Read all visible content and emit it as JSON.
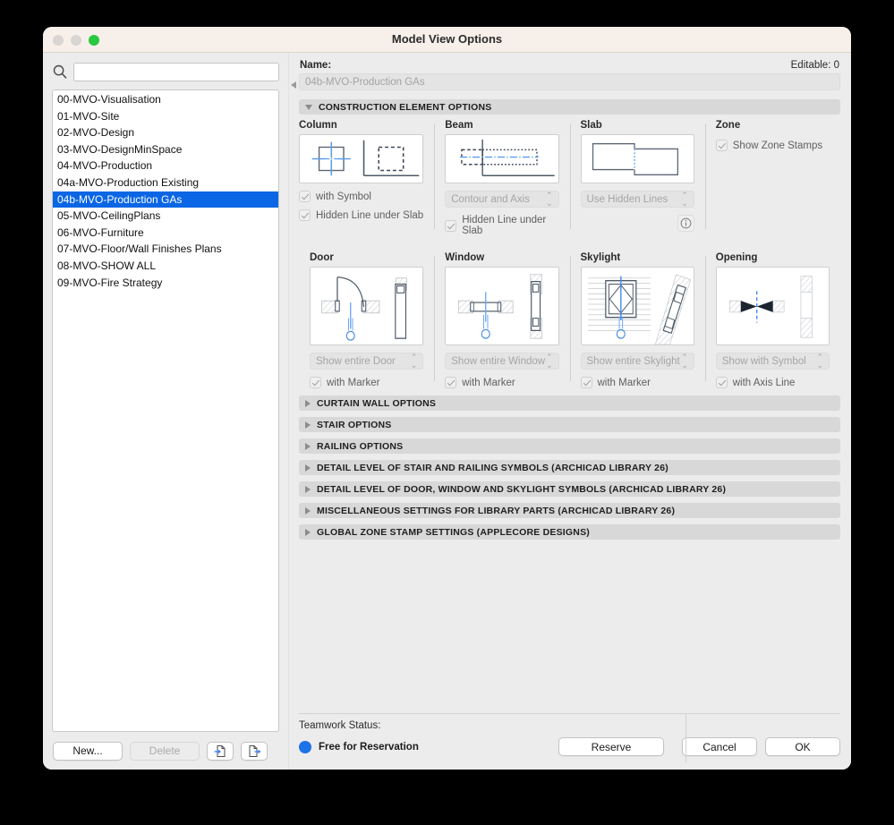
{
  "window": {
    "title": "Model View Options",
    "traffic_lights": [
      "close-inactive",
      "minimize-inactive",
      "maximize-green"
    ]
  },
  "sidebar": {
    "search": {
      "value": "",
      "placeholder": "",
      "icon": "search-icon"
    },
    "items": [
      {
        "label": "00-MVO-Visualisation",
        "selected": false
      },
      {
        "label": "01-MVO-Site",
        "selected": false
      },
      {
        "label": "02-MVO-Design",
        "selected": false
      },
      {
        "label": "03-MVO-DesignMinSpace",
        "selected": false
      },
      {
        "label": "04-MVO-Production",
        "selected": false
      },
      {
        "label": "04a-MVO-Production Existing",
        "selected": false
      },
      {
        "label": "04b-MVO-Production GAs",
        "selected": true
      },
      {
        "label": "05-MVO-CeilingPlans",
        "selected": false
      },
      {
        "label": "06-MVO-Furniture",
        "selected": false
      },
      {
        "label": "07-MVO-Floor/Wall Finishes Plans",
        "selected": false
      },
      {
        "label": "08-MVO-SHOW ALL",
        "selected": false
      },
      {
        "label": "09-MVO-Fire Strategy",
        "selected": false
      }
    ],
    "buttons": {
      "new": "New...",
      "delete": "Delete",
      "import_icon": "import-document-icon",
      "export_icon": "export-document-icon"
    },
    "selection_color": "#0a66e4"
  },
  "main": {
    "name_label": "Name:",
    "editable_label": "Editable: 0",
    "name_value": "04b-MVO-Production GAs",
    "construction_section": {
      "title": "CONSTRUCTION ELEMENT OPTIONS",
      "expanded": true
    },
    "cells": {
      "column": {
        "title": "Column",
        "preview_icon": "column-symbol-preview",
        "checkboxes": [
          {
            "label": "with Symbol",
            "checked": true
          },
          {
            "label": "Hidden Line under Slab",
            "checked": true
          }
        ]
      },
      "beam": {
        "title": "Beam",
        "preview_icon": "beam-contour-axis-preview",
        "popup": {
          "value": "Contour and Axis"
        },
        "checkboxes": [
          {
            "label": "Hidden Line under Slab",
            "checked": true
          }
        ]
      },
      "slab": {
        "title": "Slab",
        "preview_icon": "slab-hidden-lines-preview",
        "popup": {
          "value": "Use Hidden Lines"
        },
        "info_icon": "info-icon"
      },
      "zone": {
        "title": "Zone",
        "checkboxes": [
          {
            "label": "Show Zone Stamps",
            "checked": true
          }
        ]
      },
      "door": {
        "title": "Door",
        "preview_icon": "door-plan-preview",
        "popup": {
          "value": "Show entire Door"
        },
        "checkboxes": [
          {
            "label": "with Marker",
            "checked": true
          }
        ]
      },
      "window": {
        "title": "Window",
        "preview_icon": "window-plan-preview",
        "popup": {
          "value": "Show entire Window"
        },
        "checkboxes": [
          {
            "label": "with Marker",
            "checked": true
          }
        ]
      },
      "skylight": {
        "title": "Skylight",
        "preview_icon": "skylight-plan-preview",
        "popup": {
          "value": "Show entire Skylight"
        },
        "checkboxes": [
          {
            "label": "with Marker",
            "checked": true
          }
        ]
      },
      "opening": {
        "title": "Opening",
        "preview_icon": "opening-symbol-preview",
        "popup": {
          "value": "Show with Symbol"
        },
        "checkboxes": [
          {
            "label": "with Axis Line",
            "checked": true
          }
        ]
      }
    },
    "collapsed_sections": [
      {
        "title": "CURTAIN WALL OPTIONS"
      },
      {
        "title": "STAIR OPTIONS"
      },
      {
        "title": "RAILING OPTIONS"
      },
      {
        "title": "DETAIL LEVEL OF STAIR AND RAILING SYMBOLS (ARCHICAD LIBRARY 26)"
      },
      {
        "title": "DETAIL LEVEL OF DOOR, WINDOW AND SKYLIGHT SYMBOLS (ARCHICAD LIBRARY 26)"
      },
      {
        "title": "MISCELLANEOUS SETTINGS FOR LIBRARY PARTS (ARCHICAD LIBRARY 26)"
      },
      {
        "title": "GLOBAL ZONE STAMP SETTINGS (APPLECORE DESIGNS)"
      }
    ]
  },
  "footer": {
    "teamwork_label": "Teamwork Status:",
    "status_text": "Free for Reservation",
    "status_color": "#1e72e8",
    "reserve_label": "Reserve",
    "cancel_label": "Cancel",
    "ok_label": "OK"
  }
}
